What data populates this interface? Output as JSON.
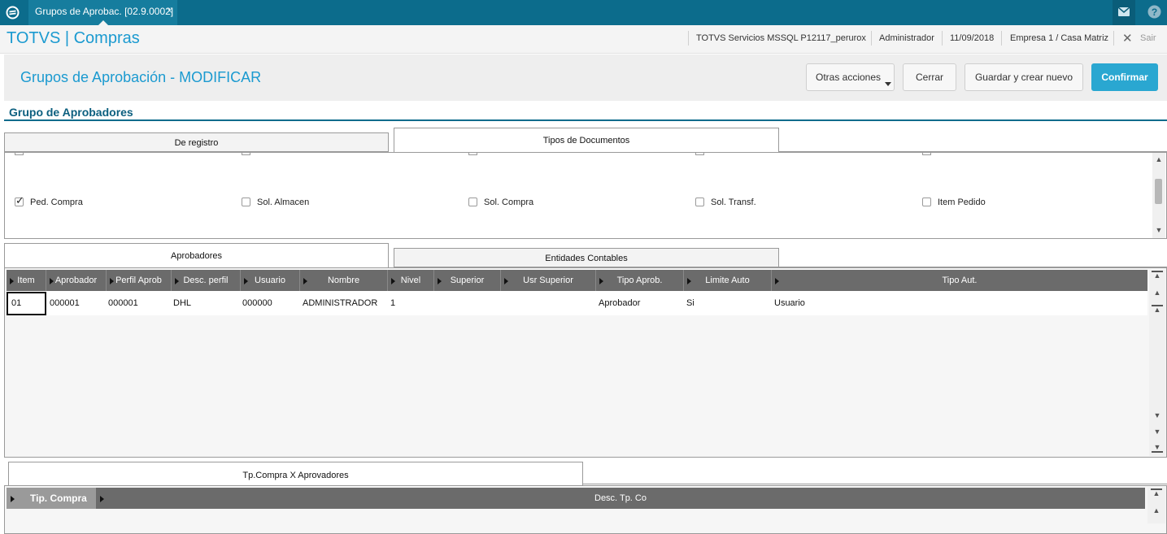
{
  "top_tab": {
    "title": "Grupos de Aprobac. [02.9.0002]",
    "close": "×"
  },
  "header": {
    "app_title": "TOTVS | Compras",
    "server": "TOTVS Servicios MSSQL P12117_perurox",
    "user": "Administrador",
    "date": "11/09/2018",
    "company": "Empresa 1 / Casa Matriz",
    "exit_label": "Sair"
  },
  "page": {
    "title": "Grupos de Aprobación - MODIFICAR"
  },
  "actions": {
    "other": "Otras acciones",
    "close": "Cerrar",
    "save_new": "Guardar y crear nuevo",
    "confirm": "Confirmar"
  },
  "section_title": "Grupo de Aprobadores",
  "tabs_top": [
    "De registro",
    "Tipos de Documentos"
  ],
  "doc_types": [
    {
      "label": "Ped. Compra",
      "checked": true
    },
    {
      "label": "Sol. Almacen",
      "checked": false
    },
    {
      "label": "Sol. Compra",
      "checked": false
    },
    {
      "label": "Sol. Transf.",
      "checked": false
    },
    {
      "label": "Item Pedido",
      "checked": false
    }
  ],
  "tabs_mid": [
    "Aprobadores",
    "Entidades Contables"
  ],
  "grid": {
    "columns": [
      "Item",
      "Aprobador",
      "Perfil Aprob",
      "Desc. perfil",
      "Usuario",
      "Nombre",
      "Nivel",
      "Superior",
      "Usr Superior",
      "Tipo Aprob.",
      "Limite Auto",
      "Tipo Aut."
    ],
    "rows": [
      [
        "01",
        "000001",
        "000001",
        "DHL",
        "000000",
        "ADMINISTRADOR",
        "1",
        "",
        "",
        "Aprobador",
        "Si",
        "Usuario"
      ]
    ]
  },
  "tabs_bottom": [
    "Tp.Compra X Aprovadores"
  ],
  "grid2": {
    "columns": [
      "Tip. Compra",
      "Desc. Tp. Co"
    ]
  },
  "colors": {
    "topbar": "#0c6c8c",
    "accent": "#1b9ad0",
    "confirm": "#2aa7d1",
    "grid_header": "#6b6b6b"
  }
}
